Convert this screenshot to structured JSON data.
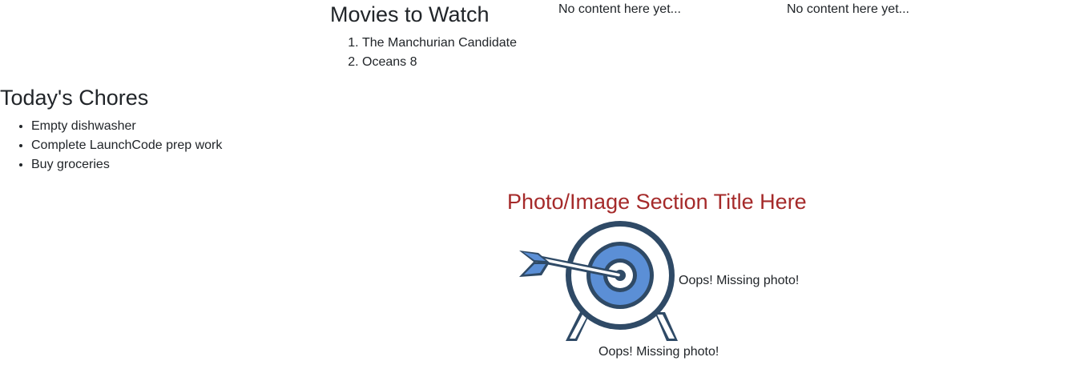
{
  "movies": {
    "title": "Movies to Watch",
    "items": [
      "The Manchurian Candidate",
      "Oceans 8"
    ]
  },
  "placeholders": {
    "column_two": "No content here yet...",
    "column_three": "No content here yet..."
  },
  "chores": {
    "title": "Today's Chores",
    "items": [
      "Empty dishwasher",
      "Complete LaunchCode prep work",
      "Buy groceries"
    ]
  },
  "photo_section": {
    "title": "Photo/Image Section Title Here",
    "image_icon": "target-with-arrow-icon",
    "missing_photo_1": "Oops! Missing photo!",
    "missing_photo_2": "Oops! Missing photo!"
  },
  "colors": {
    "text": "#212529",
    "section_title": "#a52a2a",
    "target_dark": "#2f4a66",
    "target_blue": "#5b8fd6"
  }
}
